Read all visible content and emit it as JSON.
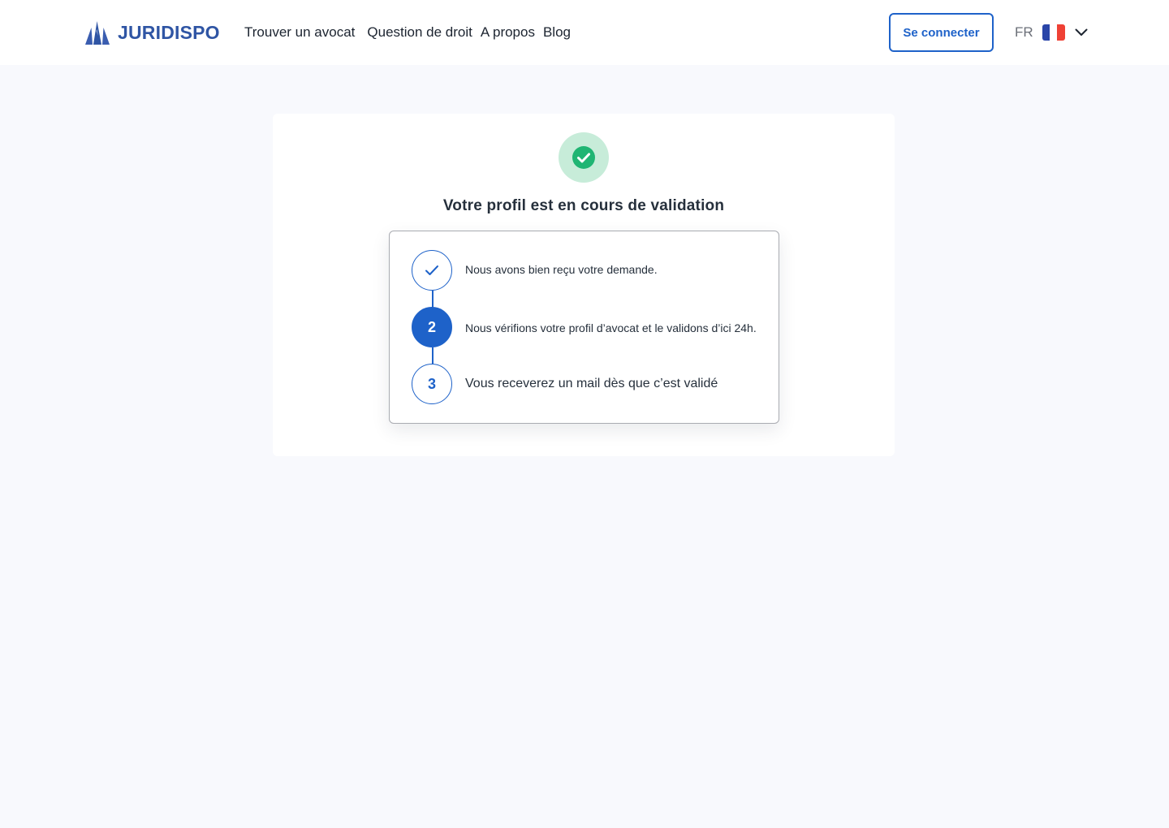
{
  "header": {
    "logo_text": "JURIDISPO",
    "nav": [
      {
        "label": "Trouver un avocat"
      },
      {
        "label": "Question de droit"
      },
      {
        "label": "A propos"
      },
      {
        "label": "Blog"
      }
    ],
    "login_label": "Se connecter",
    "language": {
      "code": "FR",
      "flag_colors": [
        "#2a45a8",
        "#ffffff",
        "#ef4135"
      ]
    }
  },
  "main": {
    "status_icon": "check-circle-icon",
    "title": "Votre profil est en cours de validation",
    "steps": [
      {
        "marker": "check-icon",
        "text": "Nous avons bien reçu votre demande.",
        "state": "done"
      },
      {
        "marker": "2",
        "text": "Nous vérifions votre profil d’avocat et le validons d’ici 24h.",
        "state": "active"
      },
      {
        "marker": "3",
        "text": "Vous receverez un mail dès que c’est validé",
        "state": "pending"
      }
    ]
  },
  "colors": {
    "brand": "#2f55a4",
    "accent": "#1e62c9",
    "success": "#1fb573",
    "success_bg": "#c7ecd9",
    "page_bg": "#f8f9fd"
  }
}
